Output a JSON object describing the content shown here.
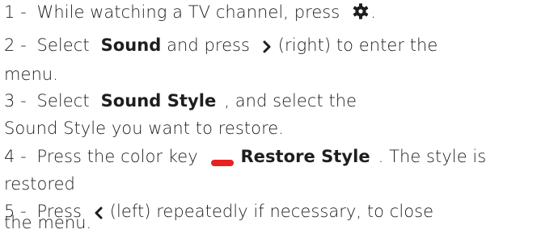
{
  "steps": [
    {
      "number": "1",
      "sep": " - ",
      "text_a": "While watching a TV channel, press",
      "icon": "gear-icon",
      "text_b": "."
    },
    {
      "number": "2",
      "sep": " - ",
      "text_a": "Select",
      "keyword": "Sound",
      "text_b": "and press",
      "icon": "chevron-right-icon",
      "text_c": "(right) to enter the",
      "text_d": "menu."
    },
    {
      "number": "3",
      "sep": " - ",
      "text_a": "Select",
      "keyword": "Sound Style",
      "text_b": ", and select the",
      "text_c": "Sound Style you want to restore."
    },
    {
      "number": "4",
      "sep": " - ",
      "text_a": "Press the color key",
      "icon": "red-key-icon",
      "keyword": "Restore Style",
      "text_b": ". The style is",
      "text_c": "restored"
    },
    {
      "number": "5",
      "sep": " - ",
      "text_a": "Press",
      "icon": "chevron-left-icon",
      "text_b": "(left) repeatedly if necessary, to close",
      "text_c": "the menu."
    }
  ],
  "colors": {
    "text": "#1e1e1e",
    "red_key": "#e8201f",
    "background": "#ffffff"
  }
}
